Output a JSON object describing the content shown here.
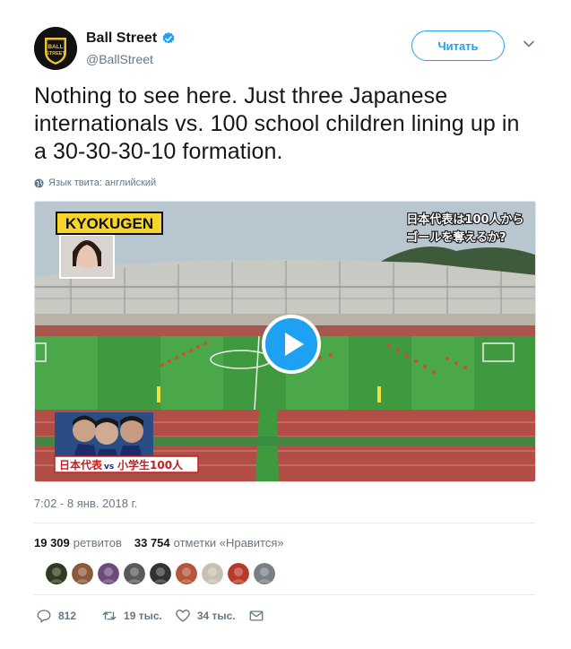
{
  "author": {
    "display_name": "Ball Street",
    "handle": "@BallStreet",
    "verified_icon": "verified-badge-icon",
    "avatar_text": "BALL STREET",
    "brand_color": "#1da1f2"
  },
  "follow_label": "Читать",
  "tweet_text": "Nothing to see here. Just three Japanese internationals vs. 100 school children lining up in a 30-30-30-10 formation.",
  "language_note": "Язык твита: английский",
  "media": {
    "logo_text": "KYOKUGEN",
    "caption_jp_line1": "日本代表は100人から",
    "caption_jp_line2": "ゴールを奪えるか?",
    "bottom_banner_left": "日本代表",
    "bottom_banner_vs": "vs",
    "bottom_banner_right": "小学生100人"
  },
  "timestamp": "7:02 - 8 янв. 2018 г.",
  "stats": {
    "retweets_count": "19 309",
    "retweets_label": "ретвитов",
    "likes_count": "33 754",
    "likes_label": "отметки «Нравится»"
  },
  "likers": [
    "#2f3a1e",
    "#8a5a3b",
    "#6b4b7a",
    "#5a5a5a",
    "#333333",
    "#b5553a",
    "#c9c0b4",
    "#b63a2a",
    "#7a7f86"
  ],
  "actions": {
    "reply_count": "812",
    "retweet_count": "19 тыс.",
    "like_count": "34 тыс."
  }
}
